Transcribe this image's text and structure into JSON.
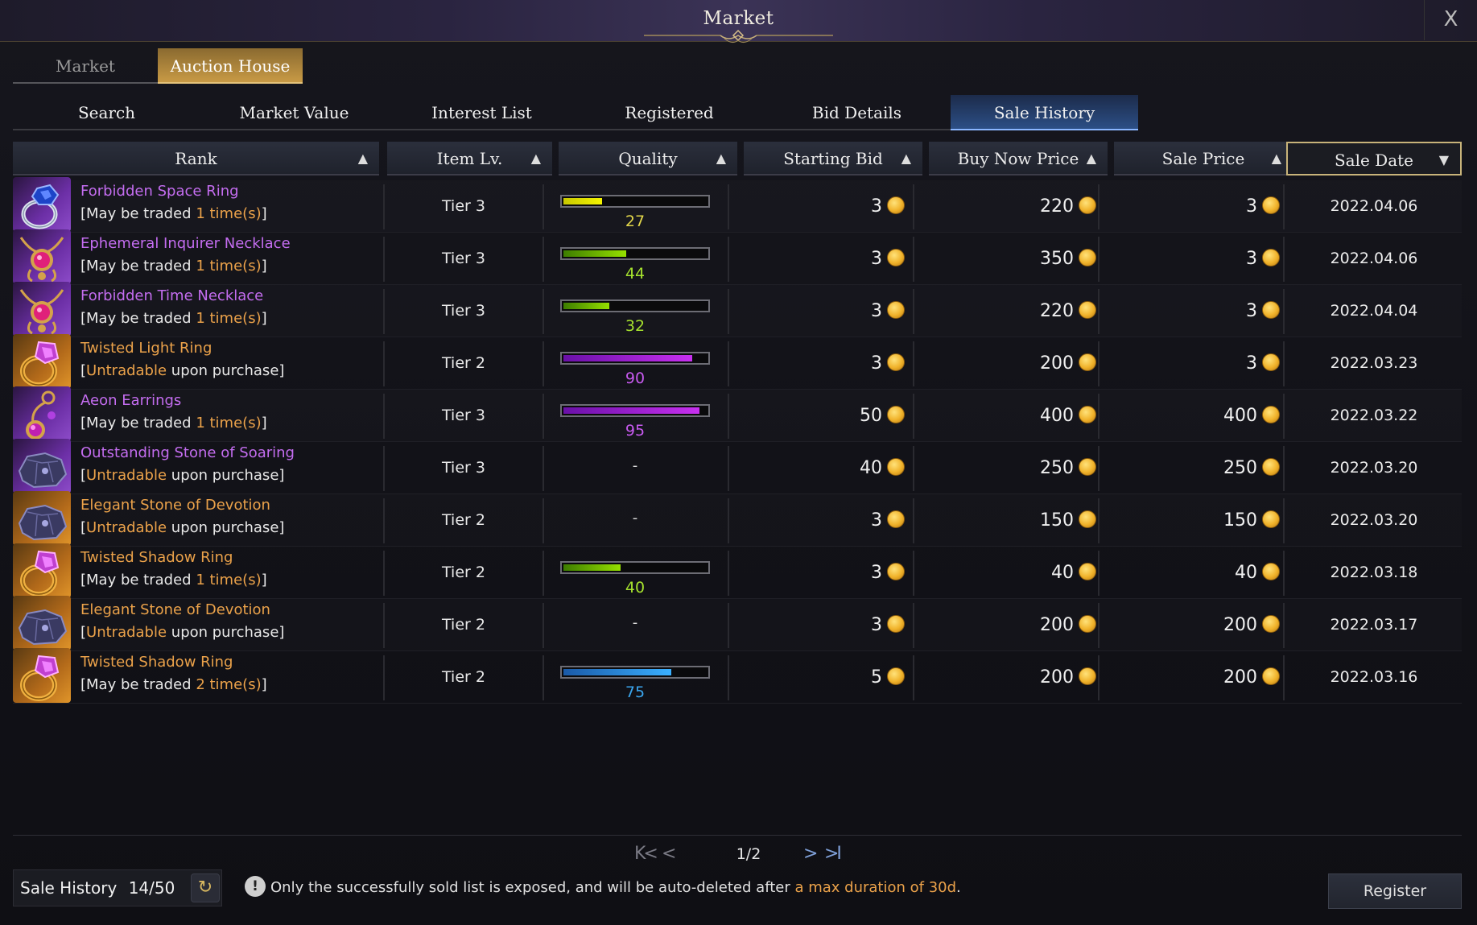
{
  "window": {
    "title": "Market",
    "close_label": "X"
  },
  "main_tabs": [
    {
      "label": "Market",
      "active": false
    },
    {
      "label": "Auction House",
      "active": true
    }
  ],
  "sub_tabs": [
    {
      "label": "Search",
      "active": false
    },
    {
      "label": "Market Value",
      "active": false
    },
    {
      "label": "Interest List",
      "active": false
    },
    {
      "label": "Registered",
      "active": false
    },
    {
      "label": "Bid Details",
      "active": false
    },
    {
      "label": "Sale History",
      "active": true
    }
  ],
  "columns": [
    {
      "label": "Rank",
      "sort": "asc"
    },
    {
      "label": "Item Lv.",
      "sort": "asc"
    },
    {
      "label": "Quality",
      "sort": "asc"
    },
    {
      "label": "Starting Bid",
      "sort": "asc"
    },
    {
      "label": "Buy Now Price",
      "sort": "asc"
    },
    {
      "label": "Sale Price",
      "sort": "asc"
    },
    {
      "label": "Sale Date",
      "sort": "desc"
    }
  ],
  "sort_icons": {
    "asc": "▲",
    "desc": "▼"
  },
  "rows": [
    {
      "name": "Forbidden Space Ring",
      "grade": "purple",
      "icon": "ring-blue-gem-icon",
      "trade_pre": "[May be traded ",
      "trade_hl": "1 time(s)",
      "trade_post": "]",
      "tier": "Tier 3",
      "quality": 27,
      "quality_text": "27",
      "quality_color": "yellow",
      "starting_bid": "3",
      "buy_now": "220",
      "sale_price": "3",
      "date": "2022.04.06"
    },
    {
      "name": "Ephemeral Inquirer Necklace",
      "grade": "purple",
      "icon": "necklace-icon",
      "trade_pre": "[May be traded ",
      "trade_hl": "1 time(s)",
      "trade_post": "]",
      "tier": "Tier 3",
      "quality": 44,
      "quality_text": "44",
      "quality_color": "green",
      "starting_bid": "3",
      "buy_now": "350",
      "sale_price": "3",
      "date": "2022.04.06"
    },
    {
      "name": "Forbidden Time Necklace",
      "grade": "purple",
      "icon": "necklace-icon",
      "trade_pre": "[May be traded ",
      "trade_hl": "1 time(s)",
      "trade_post": "]",
      "tier": "Tier 3",
      "quality": 32,
      "quality_text": "32",
      "quality_color": "green",
      "starting_bid": "3",
      "buy_now": "220",
      "sale_price": "3",
      "date": "2022.04.04"
    },
    {
      "name": "Twisted Light Ring",
      "grade": "gold",
      "icon": "ring-pink-gem-icon",
      "trade_pre": "[",
      "trade_hl": "Untradable",
      "trade_post": " upon purchase]",
      "tier": "Tier 2",
      "quality": 90,
      "quality_text": "90",
      "quality_color": "purple",
      "starting_bid": "3",
      "buy_now": "200",
      "sale_price": "3",
      "date": "2022.03.23"
    },
    {
      "name": "Aeon Earrings",
      "grade": "purple",
      "icon": "earring-icon",
      "trade_pre": "[May be traded ",
      "trade_hl": "1 time(s)",
      "trade_post": "]",
      "tier": "Tier 3",
      "quality": 95,
      "quality_text": "95",
      "quality_color": "purple",
      "starting_bid": "50",
      "buy_now": "400",
      "sale_price": "400",
      "date": "2022.03.22"
    },
    {
      "name": "Outstanding Stone of Soaring",
      "grade": "purple",
      "icon": "ability-stone-icon",
      "trade_pre": "[",
      "trade_hl": "Untradable",
      "trade_post": " upon purchase]",
      "tier": "Tier 3",
      "quality": null,
      "quality_text": "-",
      "quality_color": "none",
      "starting_bid": "40",
      "buy_now": "250",
      "sale_price": "250",
      "date": "2022.03.20"
    },
    {
      "name": "Elegant Stone of Devotion",
      "grade": "gold",
      "icon": "ability-stone-icon",
      "trade_pre": "[",
      "trade_hl": "Untradable",
      "trade_post": " upon purchase]",
      "tier": "Tier 2",
      "quality": null,
      "quality_text": "-",
      "quality_color": "none",
      "starting_bid": "3",
      "buy_now": "150",
      "sale_price": "150",
      "date": "2022.03.20"
    },
    {
      "name": "Twisted Shadow Ring",
      "grade": "gold",
      "icon": "ring-pink-gem-icon",
      "trade_pre": "[May be traded ",
      "trade_hl": "1 time(s)",
      "trade_post": "]",
      "tier": "Tier 2",
      "quality": 40,
      "quality_text": "40",
      "quality_color": "green",
      "starting_bid": "3",
      "buy_now": "40",
      "sale_price": "40",
      "date": "2022.03.18"
    },
    {
      "name": "Elegant Stone of Devotion",
      "grade": "gold",
      "icon": "ability-stone-icon",
      "trade_pre": "[",
      "trade_hl": "Untradable",
      "trade_post": " upon purchase]",
      "tier": "Tier 2",
      "quality": null,
      "quality_text": "-",
      "quality_color": "none",
      "starting_bid": "3",
      "buy_now": "200",
      "sale_price": "200",
      "date": "2022.03.17"
    },
    {
      "name": "Twisted Shadow Ring",
      "grade": "gold",
      "icon": "ring-pink-gem-icon",
      "trade_pre": "[May be traded ",
      "trade_hl": "2 time(s)",
      "trade_post": "]",
      "tier": "Tier 2",
      "quality": 75,
      "quality_text": "75",
      "quality_color": "blue",
      "starting_bid": "5",
      "buy_now": "200",
      "sale_price": "200",
      "date": "2022.03.16"
    }
  ],
  "currency_icon": "gold-coin-icon",
  "pagination": {
    "text": "1/2",
    "first": "K<",
    "prev": "<",
    "next": ">",
    "last": ">I"
  },
  "footer": {
    "history_label": "Sale History",
    "history_count": "14/50",
    "notice_pre": "Only the successfully sold list is exposed, and will be auto-deleted after ",
    "notice_hl": "a max duration of 30d",
    "notice_post": ".",
    "register_label": "Register"
  },
  "colors": {
    "grade_purple": "#c46df0",
    "grade_gold": "#eba24a",
    "active_subtab": "#2c4f86",
    "active_maintab": "#c89a45",
    "highlight": "#eba24a"
  }
}
